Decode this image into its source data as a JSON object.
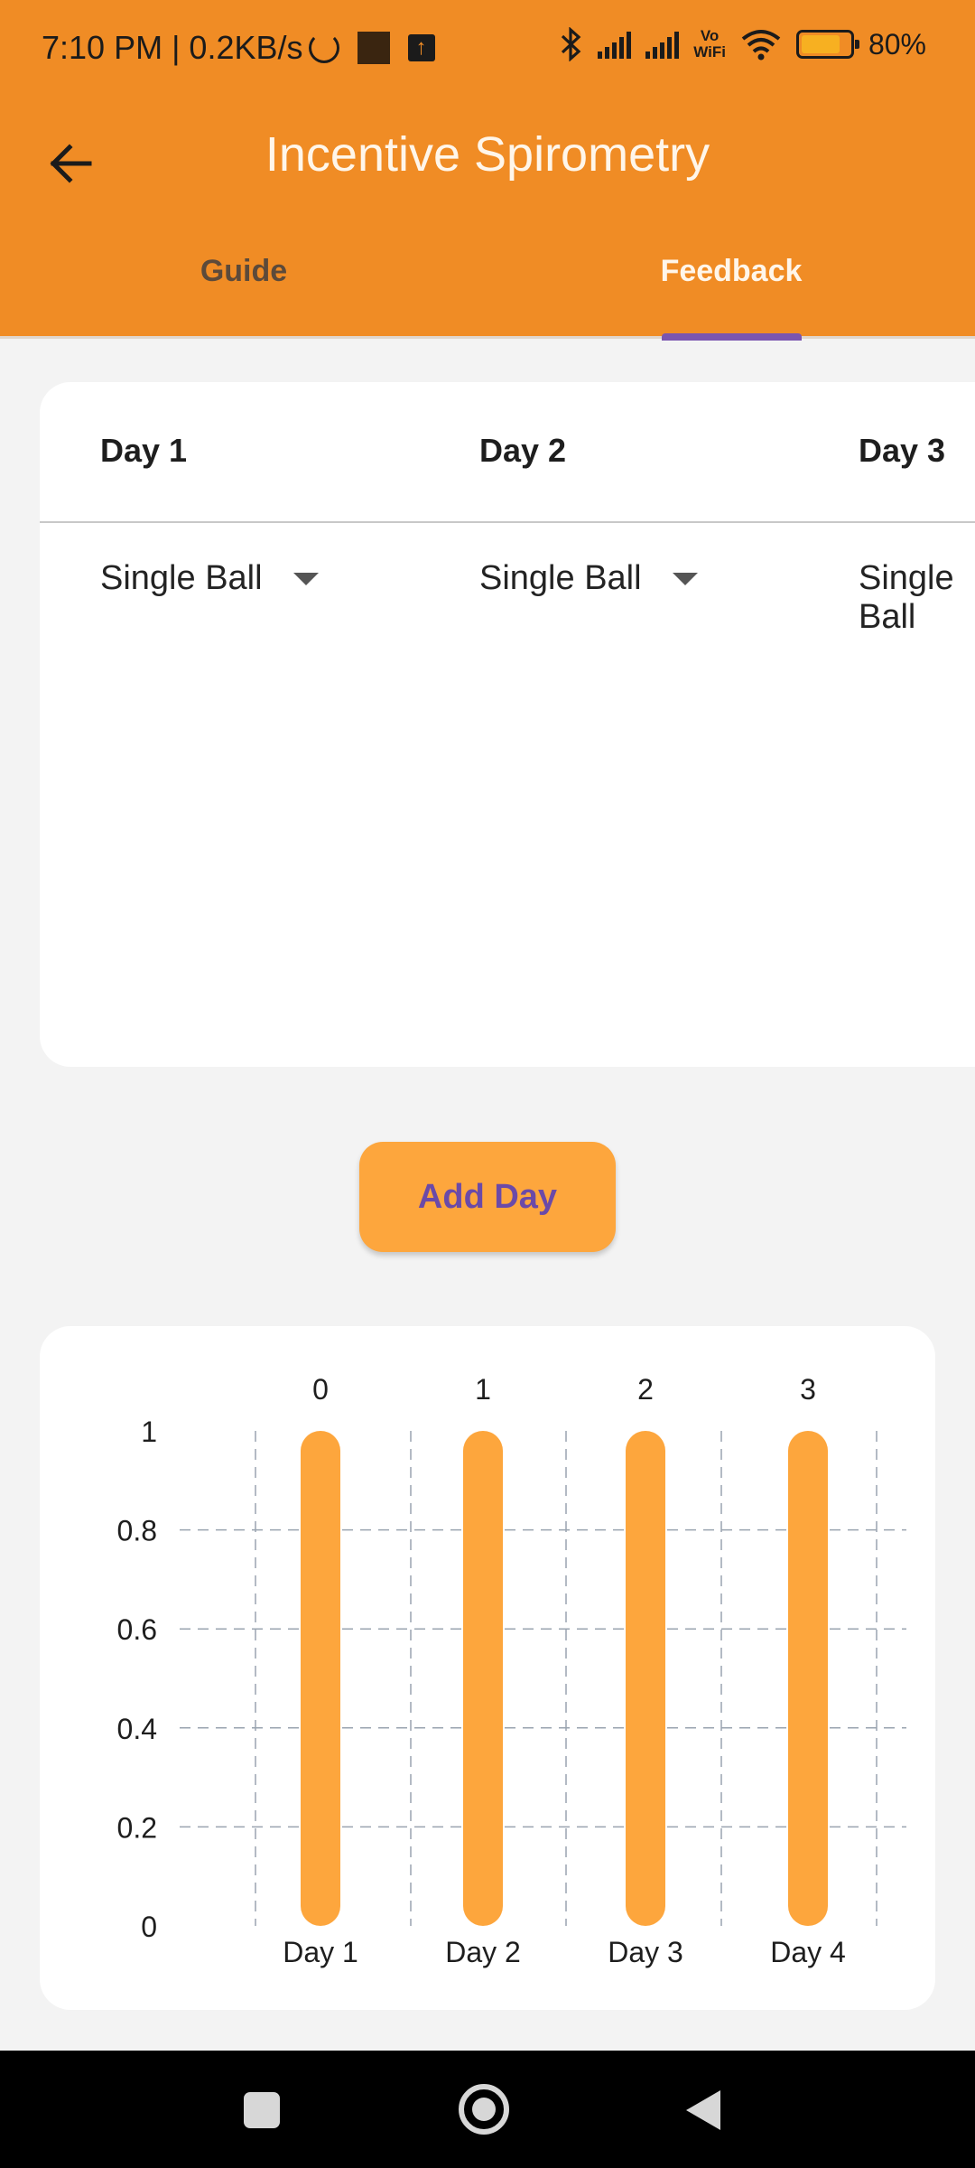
{
  "status_bar": {
    "left_text": "7:10 PM | 0.2KB/s",
    "vowifi_top": "Vo",
    "vowifi_bottom": "WiFi",
    "battery_percent_text": "80%",
    "battery_level": 0.8
  },
  "app_bar": {
    "title": "Incentive Spirometry",
    "tabs": [
      {
        "label": "Guide",
        "selected": false
      },
      {
        "label": "Feedback",
        "selected": true
      }
    ],
    "accent_color": "#f08c25",
    "indicator_color": "#7a55b0"
  },
  "table": {
    "columns": [
      {
        "header": "Day 1",
        "selection": "Single Ball"
      },
      {
        "header": "Day 2",
        "selection": "Single Ball"
      },
      {
        "header": "Day 3",
        "selection": "Single Ball"
      }
    ]
  },
  "add_day_button": {
    "label": "Add Day"
  },
  "chart_data": {
    "type": "bar",
    "categories": [
      "Day 1",
      "Day 2",
      "Day 3",
      "Day 4"
    ],
    "top_labels": [
      "0",
      "1",
      "2",
      "3"
    ],
    "values": [
      1,
      1,
      1,
      1
    ],
    "ylim": [
      0,
      1
    ],
    "yticks": [
      0,
      0.2,
      0.4,
      0.6,
      0.8,
      1
    ],
    "grid": true,
    "bar_color": "#fda63d",
    "title": "",
    "xlabel": "",
    "ylabel": ""
  },
  "nav_bar": {
    "icons": [
      "recents-icon",
      "home-icon",
      "back-icon"
    ]
  }
}
